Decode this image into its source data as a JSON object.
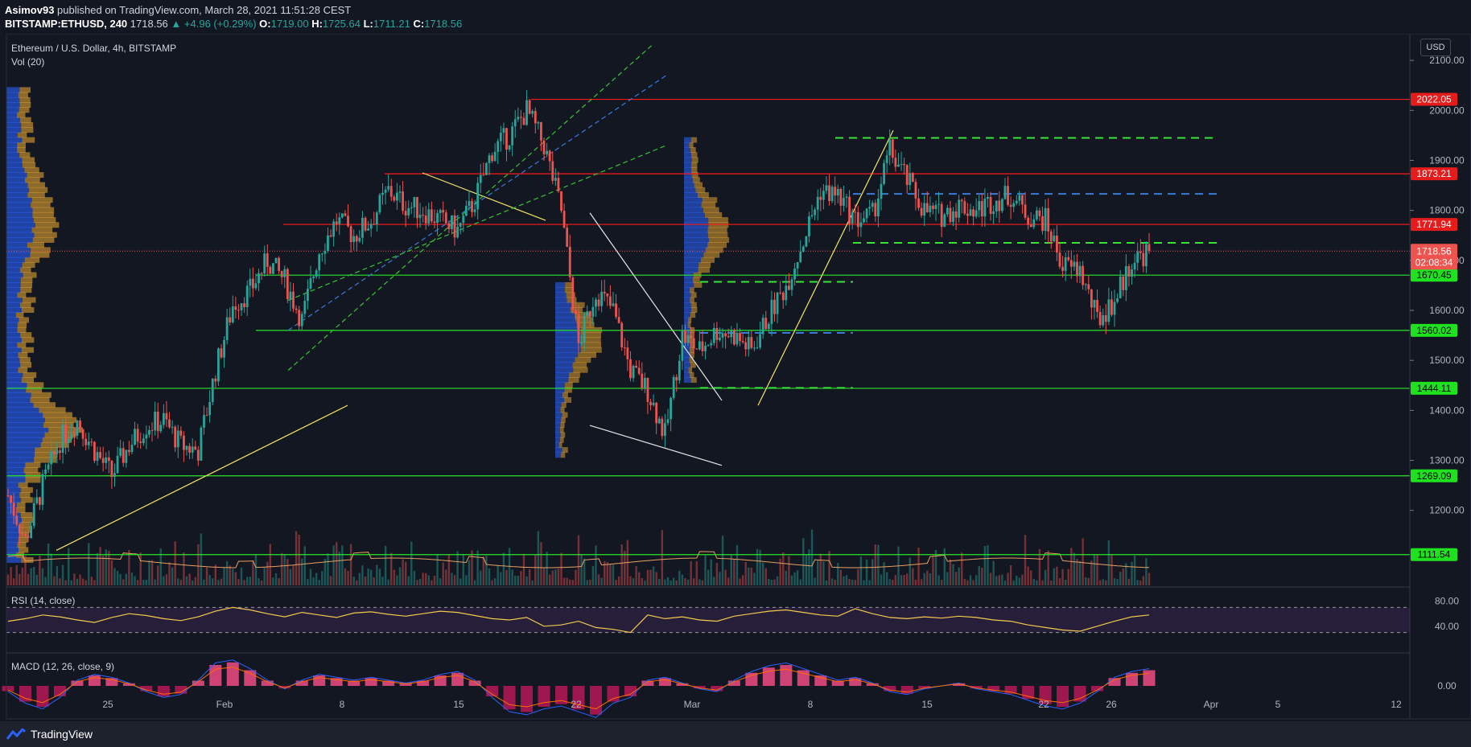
{
  "header": {
    "author": "Asimov93",
    "published_text": "published on TradingView.com, March 28, 2021 11:51:28 CEST",
    "symbol": "BITSTAMP:ETHUSD, 240",
    "last": "1718.56",
    "change": "▲ +4.96 (+0.29%)",
    "o_label": "O:",
    "o": "1719.00",
    "h_label": "H:",
    "h": "1725.64",
    "l_label": "L:",
    "l": "1711.21",
    "c_label": "C:",
    "c": "1718.56"
  },
  "legend": {
    "title": "Ethereum / U.S. Dollar, 4h, BITSTAMP",
    "vol": "Vol (20)",
    "rsi": "RSI (14, close)",
    "macd": "MACD (12, 26, close, 9)"
  },
  "currency_button": "USD",
  "footer": {
    "brand": "TradingView"
  },
  "colors": {
    "background": "#131722",
    "up": "#26a69a",
    "down": "#ef5350",
    "resistance": "#ff1a1a",
    "support": "#29e629",
    "trendline": "#f5e663",
    "rsi_line": "#f2c94c",
    "rsi_band": "#2a1f3d",
    "vp_up": "#2962ff",
    "vp_down": "#e0a030"
  },
  "chart_data": [
    {
      "type": "candlestick",
      "title": "Ethereum / U.S. Dollar, 4h, BITSTAMP",
      "ylim": [
        1050,
        2150
      ],
      "y_ticks": [
        1200,
        1300,
        1400,
        1500,
        1600,
        1700,
        1800,
        1900,
        2000,
        2100
      ],
      "y_tick_labels": [
        "1200.00",
        "1300.00",
        "1400.00",
        "1500.00",
        "1600.00",
        "1700.00",
        "1800.00",
        "1900.00",
        "2000.00",
        "2100.00"
      ],
      "x_ticks": [
        "25",
        "Feb",
        "8",
        "15",
        "22",
        "Mar",
        "8",
        "15",
        "22",
        "26",
        "Apr",
        "5",
        "12"
      ],
      "levels": [
        {
          "value": 2022.05,
          "label": "2022.05",
          "kind": "resistance"
        },
        {
          "value": 1873.21,
          "label": "1873.21",
          "kind": "resistance"
        },
        {
          "value": 1771.94,
          "label": "1771.94",
          "kind": "resistance"
        },
        {
          "value": 1670.45,
          "label": "1670.45",
          "kind": "support"
        },
        {
          "value": 1560.02,
          "label": "1560.02",
          "kind": "support"
        },
        {
          "value": 1444.11,
          "label": "1444.11",
          "kind": "support"
        },
        {
          "value": 1269.09,
          "label": "1269.09",
          "kind": "support"
        },
        {
          "value": 1111.54,
          "label": "1111.54",
          "kind": "support"
        }
      ],
      "last_price": {
        "value": 1718.56,
        "label": "1718.56",
        "countdown": "02:08:34"
      },
      "price_path": [
        [
          "Jan 21",
          1230
        ],
        [
          "Jan 22",
          1140
        ],
        [
          "Jan 23",
          1250
        ],
        [
          "Jan 24",
          1340
        ],
        [
          "Jan 25",
          1380
        ],
        [
          "Jan 26",
          1320
        ],
        [
          "Jan 27",
          1270
        ],
        [
          "Jan 28",
          1330
        ],
        [
          "Jan 29",
          1370
        ],
        [
          "Jan 30",
          1380
        ],
        [
          "Jan 31",
          1330
        ],
        [
          "Feb 1",
          1320
        ],
        [
          "Feb 2",
          1480
        ],
        [
          "Feb 3",
          1610
        ],
        [
          "Feb 4",
          1640
        ],
        [
          "Feb 5",
          1700
        ],
        [
          "Feb 6",
          1660
        ],
        [
          "Feb 7",
          1580
        ],
        [
          "Feb 8",
          1720
        ],
        [
          "Feb 9",
          1780
        ],
        [
          "Feb 10",
          1750
        ],
        [
          "Feb 11",
          1780
        ],
        [
          "Feb 12",
          1840
        ],
        [
          "Feb 13",
          1810
        ],
        [
          "Feb 14",
          1800
        ],
        [
          "Feb 15",
          1780
        ],
        [
          "Feb 16",
          1760
        ],
        [
          "Feb 17",
          1820
        ],
        [
          "Feb 18",
          1920
        ],
        [
          "Feb 19",
          1950
        ],
        [
          "Feb 20",
          2000
        ],
        [
          "Feb 21",
          1930
        ],
        [
          "Feb 22",
          1800
        ],
        [
          "Feb 23",
          1530
        ],
        [
          "Feb 24",
          1640
        ],
        [
          "Feb 25",
          1600
        ],
        [
          "Feb 26",
          1480
        ],
        [
          "Feb 27",
          1440
        ],
        [
          "Feb 28",
          1350
        ],
        [
          "Mar 1",
          1550
        ],
        [
          "Mar 2",
          1520
        ],
        [
          "Mar 3",
          1560
        ],
        [
          "Mar 4",
          1550
        ],
        [
          "Mar 5",
          1520
        ],
        [
          "Mar 6",
          1590
        ],
        [
          "Mar 7",
          1650
        ],
        [
          "Mar 8",
          1740
        ],
        [
          "Mar 9",
          1840
        ],
        [
          "Mar 10",
          1830
        ],
        [
          "Mar 11",
          1780
        ],
        [
          "Mar 12",
          1790
        ],
        [
          "Mar 13",
          1920
        ],
        [
          "Mar 14",
          1860
        ],
        [
          "Mar 15",
          1800
        ],
        [
          "Mar 16",
          1790
        ],
        [
          "Mar 17",
          1810
        ],
        [
          "Mar 18",
          1800
        ],
        [
          "Mar 19",
          1820
        ],
        [
          "Mar 20",
          1830
        ],
        [
          "Mar 21",
          1790
        ],
        [
          "Mar 22",
          1780
        ],
        [
          "Mar 23",
          1690
        ],
        [
          "Mar 24",
          1680
        ],
        [
          "Mar 25",
          1580
        ],
        [
          "Mar 26",
          1620
        ],
        [
          "Mar 27",
          1700
        ],
        [
          "Mar 28",
          1718.56
        ]
      ]
    },
    {
      "type": "line",
      "name": "RSI (14, close)",
      "ylim": [
        0,
        100
      ],
      "y_ticks": [
        40,
        80
      ],
      "y_tick_labels": [
        "40.00",
        "80.00"
      ],
      "bands": [
        30,
        70
      ],
      "values": [
        48,
        52,
        58,
        55,
        50,
        46,
        54,
        60,
        57,
        52,
        49,
        55,
        64,
        70,
        66,
        60,
        55,
        62,
        58,
        54,
        61,
        63,
        59,
        56,
        60,
        64,
        62,
        57,
        52,
        50,
        54,
        40,
        42,
        48,
        38,
        35,
        30,
        58,
        52,
        55,
        50,
        48,
        56,
        60,
        64,
        66,
        62,
        58,
        56,
        68,
        60,
        54,
        52,
        55,
        53,
        56,
        54,
        50,
        48,
        42,
        38,
        34,
        32,
        40,
        48,
        55,
        58
      ]
    },
    {
      "type": "bar",
      "name": "MACD (12, 26, close, 9)",
      "ylim": [
        -60,
        60
      ],
      "y_ticks": [
        0
      ],
      "y_tick_labels": [
        "0.00"
      ],
      "values": [
        -10,
        -30,
        -40,
        -20,
        10,
        20,
        15,
        5,
        -10,
        -20,
        -15,
        10,
        40,
        45,
        30,
        10,
        -5,
        10,
        20,
        15,
        10,
        15,
        10,
        5,
        10,
        20,
        25,
        10,
        -20,
        -45,
        -50,
        -40,
        -35,
        -45,
        -55,
        -30,
        -20,
        10,
        15,
        5,
        -5,
        -10,
        10,
        25,
        35,
        40,
        30,
        20,
        10,
        15,
        5,
        -10,
        -15,
        -5,
        0,
        5,
        -5,
        -10,
        -15,
        -25,
        -35,
        -40,
        -30,
        -10,
        15,
        25,
        30
      ]
    }
  ]
}
